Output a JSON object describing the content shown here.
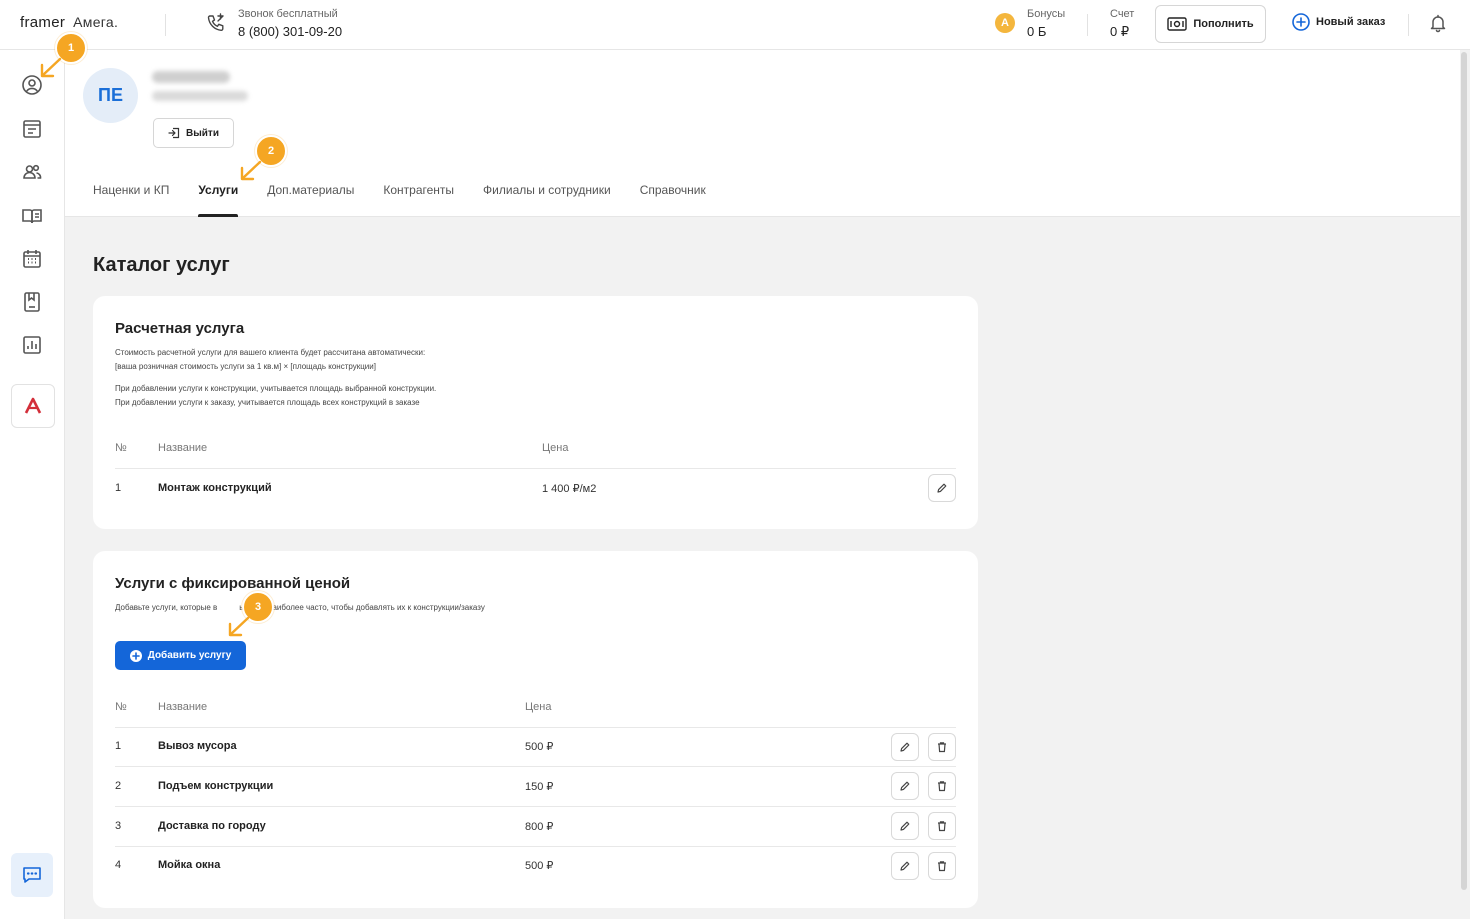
{
  "header": {
    "logo_primary": "framer",
    "logo_secondary": "Амега.",
    "phone_label": "Звонок бесплатный",
    "phone_number": "8 (800) 301-09-20",
    "bonus_label": "Бонусы",
    "bonus_value": "0 Б",
    "account_label": "Счет",
    "account_value": "0 ₽",
    "topup_label": "Пополнить",
    "new_order_label": "Новый заказ",
    "accent_color": "#1466d9"
  },
  "sidebar": {
    "items": [
      "user-circle-icon",
      "orders-icon",
      "users-icon",
      "book-icon",
      "calendar-icon",
      "album-icon",
      "chart-icon"
    ],
    "brand_icon": "amega-logo-icon",
    "chat_icon": "chat-icon"
  },
  "profile": {
    "initials": "ПЕ",
    "logout_label": "Выйти"
  },
  "tabs": [
    {
      "label": "Наценки и КП",
      "active": false
    },
    {
      "label": "Услуги",
      "active": true
    },
    {
      "label": "Доп.материалы",
      "active": false
    },
    {
      "label": "Контрагенты",
      "active": false
    },
    {
      "label": "Филиалы и сотрудники",
      "active": false
    },
    {
      "label": "Справочник",
      "active": false
    }
  ],
  "page": {
    "title": "Каталог услуг"
  },
  "calculated": {
    "title": "Расчетная услуга",
    "desc": [
      "Стоимость расчетной услуги для вашего клиента будет рассчитана автоматически:",
      "[ваша розничная стоимость услуги за 1 кв.м] × [площадь конструкции]",
      "При добавлении услуги к конструкции, учитывается площадь выбранной конструкции.",
      "При добавлении услуги к заказу, учитывается площадь всех конструкций в заказе"
    ],
    "columns": {
      "num": "№",
      "name": "Название",
      "price": "Цена"
    },
    "rows": [
      {
        "num": "1",
        "name": "Монтаж конструкций",
        "price": "1 400 ₽/м2"
      }
    ]
  },
  "fixed": {
    "title": "Услуги с фиксированной ценой",
    "desc_start": "Добавьте услуги, которые в",
    "desc_end": "ываете наиболее часто, чтобы добавлять их к конструкции/заказу",
    "add_label": "Добавить услугу",
    "columns": {
      "num": "№",
      "name": "Название",
      "price": "Цена"
    },
    "rows": [
      {
        "num": "1",
        "name": "Вывоз мусора",
        "price": "500 ₽"
      },
      {
        "num": "2",
        "name": "Подъем конструкции",
        "price": "150 ₽"
      },
      {
        "num": "3",
        "name": "Доставка по городу",
        "price": "800 ₽"
      },
      {
        "num": "4",
        "name": "Мойка окна",
        "price": "500 ₽"
      }
    ]
  },
  "callouts": [
    "1",
    "2",
    "3"
  ],
  "callout_color": "#f5a623"
}
